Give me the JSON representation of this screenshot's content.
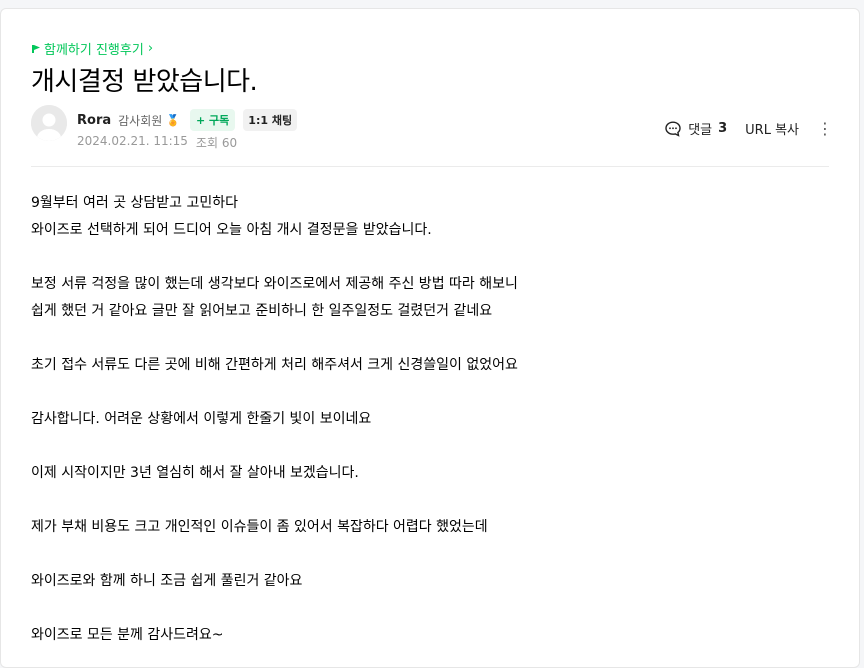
{
  "breadcrumb": {
    "label": "함께하기 진행후기",
    "chevron": "›"
  },
  "post": {
    "title": "개시결정 받았습니다.",
    "author": {
      "nickname": "Rora",
      "grade": "감사회원",
      "medal_icon": "medal-icon"
    },
    "subscribe_label": "+ 구독",
    "chat_label": "1:1 채팅",
    "date": "2024.02.21. 11:15",
    "views_label": "조회 60",
    "comments_label": "댓글",
    "comments_count": "3",
    "url_copy_label": "URL 복사",
    "body_lines": [
      "9월부터 여러 곳 상담받고 고민하다",
      "와이즈로 선택하게 되어 드디어 오늘 아침 개시 결정문을 받았습니다.",
      "",
      "보정 서류 걱정을 많이 했는데 생각보다 와이즈로에서 제공해 주신 방법 따라 해보니",
      "쉽게 했던 거 같아요 글만 잘 읽어보고 준비하니 한 일주일정도 걸렸던거 같네요",
      "",
      "초기 접수 서류도 다른 곳에 비해 간편하게 처리 해주셔서 크게 신경쓸일이 없었어요",
      "",
      "감사합니다. 어려운 상황에서 이렇게 한줄기 빛이 보이네요",
      "",
      "이제 시작이지만 3년 열심히 해서 잘 살아내 보겠습니다.",
      "",
      "제가 부채 비용도 크고 개인적인 이슈들이 좀 있어서 복잡하다 어렵다 했었는데",
      "",
      "와이즈로와 함께 하니 조금 쉽게 풀린거 같아요",
      "",
      "와이즈로 모든 분께 감사드려요~"
    ]
  },
  "colors": {
    "accent": "#03c75a",
    "meta": "#999999"
  }
}
